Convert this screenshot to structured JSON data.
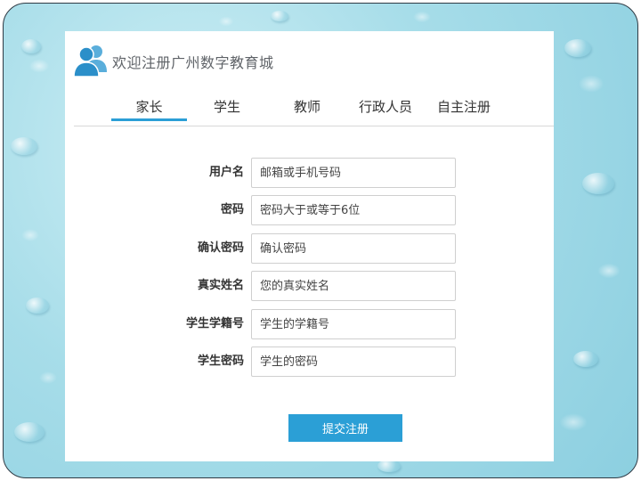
{
  "header": {
    "logo_icon": "user-group-icon",
    "title": "欢迎注册广州数字教育城"
  },
  "tabs": [
    {
      "label": "家长",
      "active": true
    },
    {
      "label": "学生",
      "active": false
    },
    {
      "label": "教师",
      "active": false
    },
    {
      "label": "行政人员",
      "active": false
    },
    {
      "label": "自主注册",
      "active": false
    }
  ],
  "form": {
    "fields": [
      {
        "label": "用户名",
        "placeholder": "邮箱或手机号码",
        "value": ""
      },
      {
        "label": "密码",
        "placeholder": "密码大于或等于6位",
        "value": ""
      },
      {
        "label": "确认密码",
        "placeholder": "确认密码",
        "value": ""
      },
      {
        "label": "真实姓名",
        "placeholder": "您的真实姓名",
        "value": ""
      },
      {
        "label": "学生学籍号",
        "placeholder": "学生的学籍号",
        "value": ""
      },
      {
        "label": "学生密码",
        "placeholder": "学生的密码",
        "value": ""
      }
    ],
    "submit_label": "提交注册"
  },
  "colors": {
    "accent": "#2b9fd6",
    "background": "#a7dde9",
    "logo": "#2b8fc9"
  }
}
